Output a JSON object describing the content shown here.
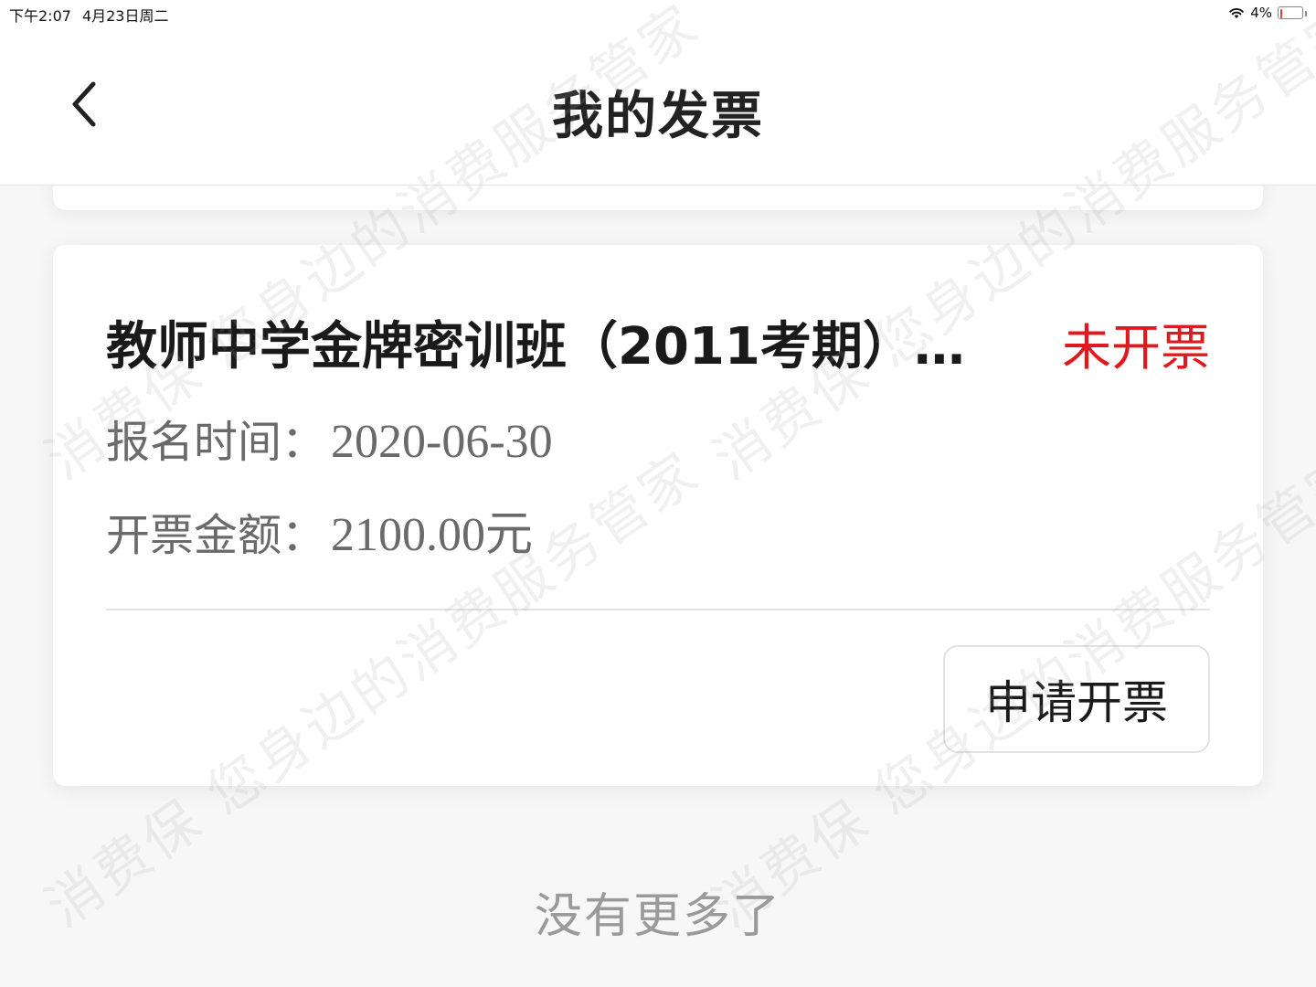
{
  "status_bar": {
    "time": "下午2:07",
    "date": "4月23日周二",
    "battery_percent": "4%",
    "battery_level": 0.04,
    "battery_level_color": "#e03a3a"
  },
  "nav": {
    "title": "我的发票",
    "back_icon": "chevron-left-icon"
  },
  "invoice": {
    "course_title": "教师中学金牌密训班（2011考期）…",
    "status": "未开票",
    "status_color": "#e0191e",
    "date_label": "报名时间：",
    "date_value": "2020-06-30",
    "amount_label": "开票金额：",
    "amount_value": "2100.00元",
    "apply_button": "申请开票"
  },
  "footer": {
    "no_more": "没有更多了"
  },
  "watermark": {
    "text_a": "消费保 您身边的消费服务管家",
    "text_b": "消费保 您身边的消费服务管家",
    "text_c": "消费保 您身边的消费服务管家",
    "text_d": "消费保 您身边的消费服务管家"
  }
}
